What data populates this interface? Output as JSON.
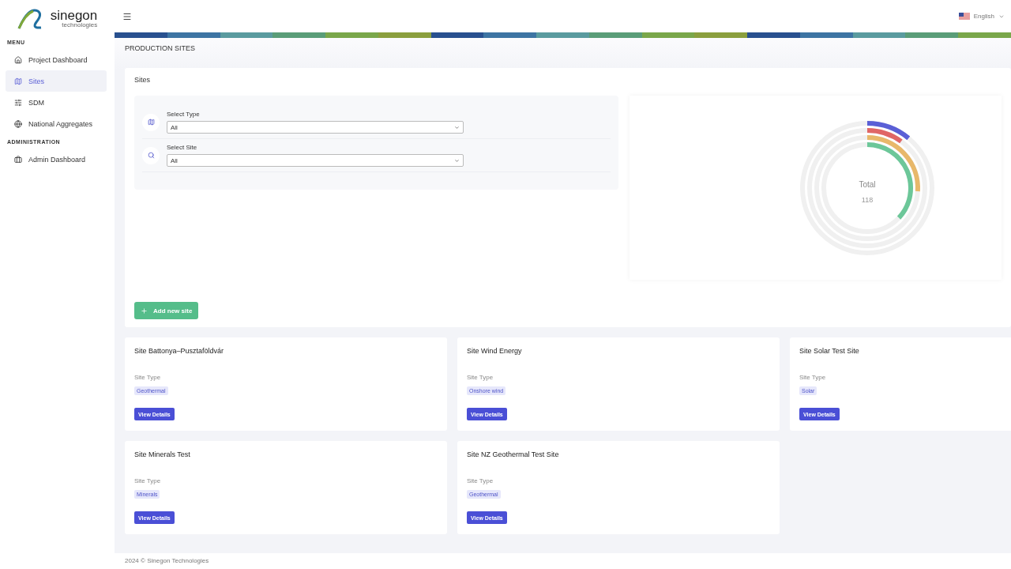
{
  "logo": {
    "name": "sinegon",
    "tagline": "technologies"
  },
  "sidebar": {
    "sections": [
      {
        "title": "MENU",
        "items": [
          {
            "label": "Project Dashboard",
            "kind": "home",
            "selected": false
          },
          {
            "label": "Sites",
            "kind": "map",
            "selected": true
          },
          {
            "label": "SDM",
            "kind": "sliders",
            "selected": false
          },
          {
            "label": "National Aggregates",
            "kind": "globe",
            "selected": false
          }
        ]
      },
      {
        "title": "ADMINISTRATION",
        "items": [
          {
            "label": "Admin Dashboard",
            "kind": "briefcase",
            "selected": false
          }
        ]
      }
    ]
  },
  "topbar": {
    "language": "English"
  },
  "page_title": "PRODUCTION SITES",
  "filters_card": {
    "title": "Sites",
    "filters": [
      {
        "label": "Select Type",
        "value": "All",
        "kind": "map"
      },
      {
        "label": "Select Site",
        "value": "All",
        "kind": "search"
      }
    ],
    "chart": {
      "total_label": "Total",
      "total_value": "118"
    },
    "add_button": "Add new site"
  },
  "sites": [
    {
      "name": "Site Battonya–Pusztaföldvár",
      "type_label": "Site Type",
      "type": "Geothermal",
      "button": "View Details"
    },
    {
      "name": "Site Wind Energy",
      "type_label": "Site Type",
      "type": "Onshore wind",
      "button": "View Details"
    },
    {
      "name": "Site Solar Test Site",
      "type_label": "Site Type",
      "type": "Solar",
      "button": "View Details"
    },
    {
      "name": "Site Minerals Test",
      "type_label": "Site Type",
      "type": "Minerals",
      "button": "View Details"
    },
    {
      "name": "Site NZ Geothermal Test Site",
      "type_label": "Site Type",
      "type": "Geothermal",
      "button": "View Details"
    }
  ],
  "footer": "2024 © Sinegon Technologies"
}
